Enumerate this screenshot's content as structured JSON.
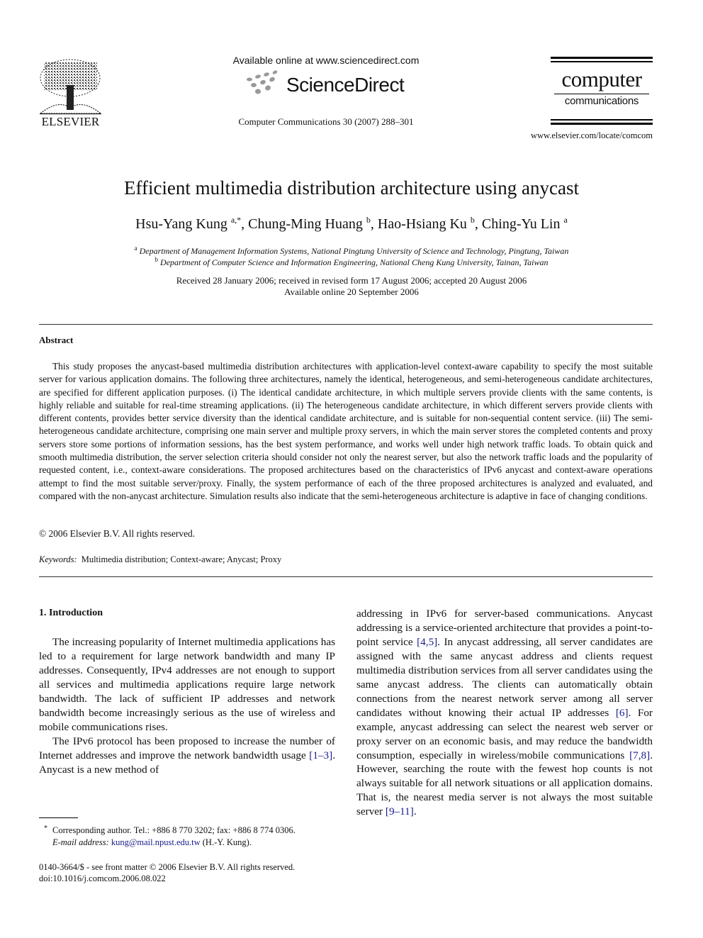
{
  "header": {
    "publisher_logo": "ELSEVIER",
    "available_online": "Available online at www.sciencedirect.com",
    "sciencedirect_logo": "ScienceDirect",
    "journal_reference": "Computer Communications 30 (2007) 288–301",
    "journal_logo_line1": "computer",
    "journal_logo_line2": "communications",
    "journal_url": "www.elsevier.com/locate/comcom"
  },
  "article": {
    "title": "Efficient multimedia distribution architecture using anycast",
    "authors": [
      {
        "name": "Hsu-Yang Kung",
        "marks": "a,*"
      },
      {
        "name": "Chung-Ming Huang",
        "marks": "b"
      },
      {
        "name": "Hao-Hsiang Ku",
        "marks": "b"
      },
      {
        "name": "Ching-Yu Lin",
        "marks": "a"
      }
    ],
    "affiliations": [
      {
        "mark": "a",
        "text": "Department of Management Information Systems, National Pingtung University of Science and Technology, Pingtung, Taiwan"
      },
      {
        "mark": "b",
        "text": "Department of Computer Science and Information Engineering, National Cheng Kung University, Tainan, Taiwan"
      }
    ],
    "received": "Received 28 January 2006; received in revised form 17 August 2006; accepted 20 August 2006",
    "available": "Available online 20 September 2006"
  },
  "abstract": {
    "heading": "Abstract",
    "body": "This study proposes the anycast-based multimedia distribution architectures with application-level context-aware capability to specify the most suitable server for various application domains. The following three architectures, namely the identical, heterogeneous, and semi-heterogeneous candidate architectures, are specified for different application purposes. (i) The identical candidate architecture, in which multiple servers provide clients with the same contents, is highly reliable and suitable for real-time streaming applications. (ii) The heterogeneous candidate architecture, in which different servers provide clients with different contents, provides better service diversity than the identical candidate architecture, and is suitable for non-sequential content service. (iii) The semi-heterogeneous candidate architecture, comprising one main server and multiple proxy servers, in which the main server stores the completed contents and proxy servers store some portions of information sessions, has the best system performance, and works well under high network traffic loads. To obtain quick and smooth multimedia distribution, the server selection criteria should consider not only the nearest server, but also the network traffic loads and the popularity of requested content, i.e., context-aware considerations. The proposed architectures based on the characteristics of IPv6 anycast and context-aware operations attempt to find the most suitable server/proxy. Finally, the system performance of each of the three proposed architectures is analyzed and evaluated, and compared with the non-anycast architecture. Simulation results also indicate that the semi-heterogeneous architecture is adaptive in face of changing conditions.",
    "copyright": "© 2006 Elsevier B.V. All rights reserved.",
    "keywords_label": "Keywords:",
    "keywords": "Multimedia distribution; Context-aware; Anycast; Proxy"
  },
  "introduction": {
    "heading": "1. Introduction",
    "p1": "The increasing popularity of Internet multimedia applications has led to a requirement for large network bandwidth and many IP addresses. Consequently, IPv4 addresses are not enough to support all services and multimedia applications require large network bandwidth. The lack of sufficient IP addresses and network bandwidth become increasingly serious as the use of wireless and mobile communications rises.",
    "p2_a": "The IPv6 protocol has been proposed to increase the number of Internet addresses and improve the network bandwidth usage ",
    "cite_1": "[1–3]",
    "p2_b": ". Anycast is a new method of addressing in IPv6 for server-based communications. Anycast addressing is a service-oriented architecture that provides a point-to-point service ",
    "cite_2": "[4,5]",
    "p2_c": ". In anycast addressing, all server candidates are assigned with the same anycast address and clients request multimedia distribution services from all server candidates using the same anycast address. The clients can automatically obtain connections from the nearest network server among all server candidates without knowing their actual IP addresses ",
    "cite_3": "[6]",
    "p2_d": ". For example, anycast addressing can select the nearest web server or proxy server on an economic basis, and may reduce the bandwidth consumption, especially in wireless/mobile communications ",
    "cite_4": "[7,8]",
    "p2_e": ". However, searching the route with the fewest hop counts is not always suitable for all network situations or all application domains. That is, the nearest media server is not always the most suitable server ",
    "cite_5": "[9–11]",
    "p2_f": "."
  },
  "footnotes": {
    "star": "*",
    "corresponding": "Corresponding author. Tel.: +886 8 770 3202; fax: +886 8 774 0306.",
    "email_label": "E-mail address:",
    "email": "kung@mail.npust.edu.tw",
    "email_suffix": " (H.-Y. Kung).",
    "issn": "0140-3664/$ - see front matter © 2006 Elsevier B.V. All rights reserved.",
    "doi": "doi:10.1016/j.comcom.2006.08.022"
  },
  "colors": {
    "link": "#1a1a8c",
    "logo_gray": "#999999"
  }
}
